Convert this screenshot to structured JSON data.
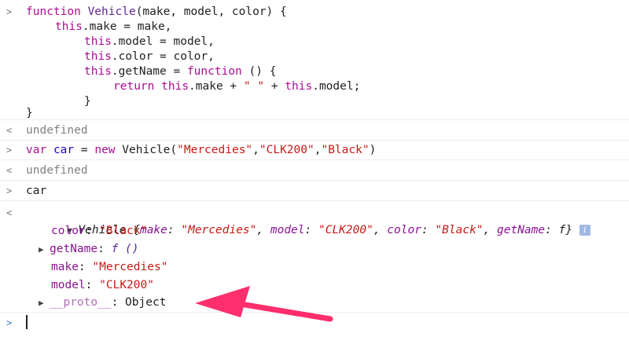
{
  "prompts": {
    "input": ">",
    "output": "<",
    "active": ">"
  },
  "fn": {
    "line1": {
      "kw": "function",
      "name": "Vehicle",
      "params": "(make, model, color) {"
    },
    "line2": {
      "kw": "this",
      "rest": ".make = make,"
    },
    "line3": {
      "kw": "this",
      "rest": ".model = model,"
    },
    "line4": {
      "kw": "this",
      "rest": ".color = color,"
    },
    "line5": {
      "kw": "this",
      "mid": ".getName = ",
      "kw2": "function",
      "rest": " () {"
    },
    "line6": {
      "kw": "return",
      "this1": "this",
      "p1": ".make + ",
      "s": "\" \"",
      "p2": " + ",
      "this2": "this",
      "p3": ".model;"
    },
    "line7": "}",
    "line8": "}"
  },
  "result1": "undefined",
  "stmt2": {
    "kw": "var",
    "var": "car",
    "eq": " = ",
    "kw2": "new",
    "call": " Vehicle(",
    "a1": "\"Mercedies\"",
    "c1": ",",
    "a2": "\"CLK200\"",
    "c2": ",",
    "a3": "\"Black\"",
    "close": ")"
  },
  "result2": "undefined",
  "stmt3": "car",
  "object": {
    "summary": {
      "name": "Vehicle",
      "open": " {",
      "k1": "make",
      "v1": "\"Mercedies\"",
      "k2": "model",
      "v2": "\"CLK200\"",
      "k3": "color",
      "v3": "\"Black\"",
      "k4": "getName",
      "v4": "f",
      "close": "}",
      "info": "i"
    },
    "props": {
      "color": {
        "key": "color",
        "value": "\"Black\""
      },
      "getName": {
        "key": "getName",
        "value": "f ()"
      },
      "make": {
        "key": "make",
        "value": "\"Mercedies\""
      },
      "model": {
        "key": "model",
        "value": "\"CLK200\""
      },
      "proto": {
        "key": "__proto__",
        "value": "Object"
      }
    }
  },
  "colors": {
    "annotation_arrow": "#ff2e6d",
    "prompt_blue": "#2d7cd6"
  }
}
